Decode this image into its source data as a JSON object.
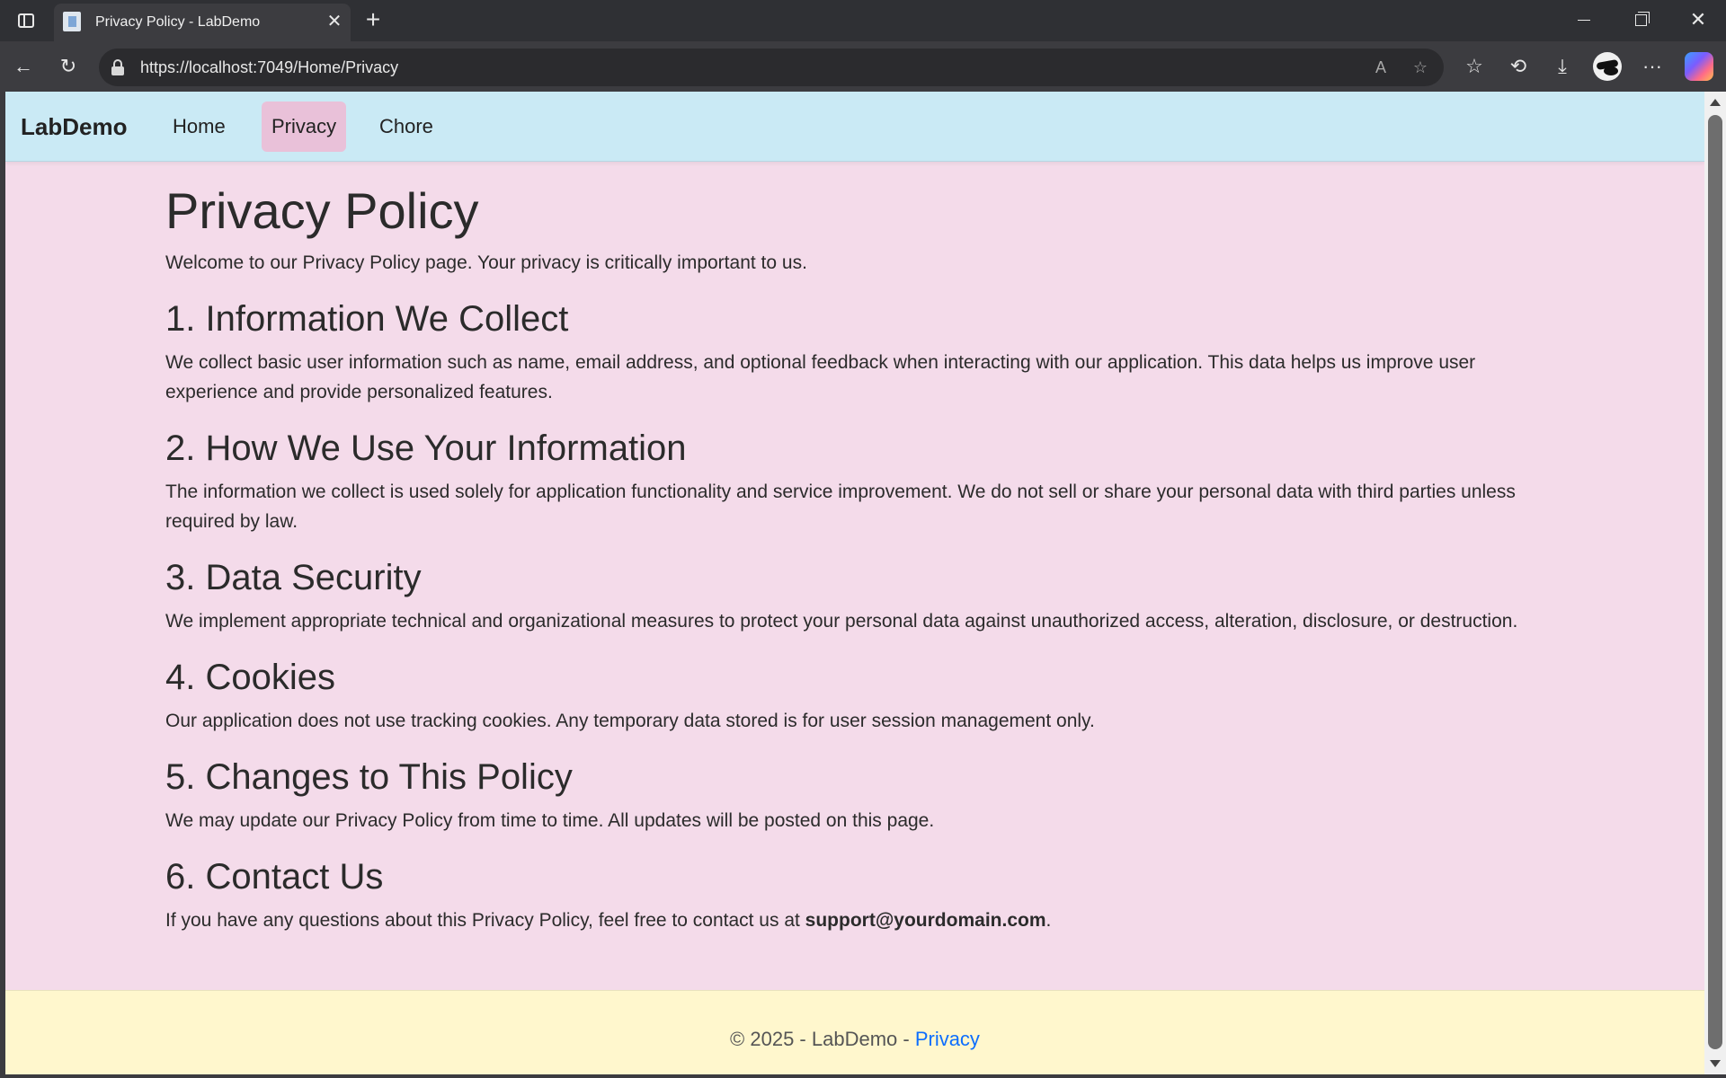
{
  "browser": {
    "tab_title": "Privacy Policy - LabDemo",
    "tab_close": "✕",
    "new_tab": "+",
    "url": "https://localhost:7049/Home/Privacy",
    "back": "←",
    "reload": "↻",
    "read_aloud": "A",
    "favorite": "☆",
    "favorites": "☆",
    "history": "⟲",
    "downloads": "⤓",
    "more": "···",
    "win_close": "✕"
  },
  "navbar": {
    "brand": "LabDemo",
    "links": [
      "Home",
      "Privacy",
      "Chore"
    ]
  },
  "content": {
    "title": "Privacy Policy",
    "intro": "Welcome to our Privacy Policy page. Your privacy is critically important to us.",
    "sections": [
      {
        "heading": "1. Information We Collect",
        "text": "We collect basic user information such as name, email address, and optional feedback when interacting with our application. This data helps us improve user experience and provide personalized features."
      },
      {
        "heading": "2. How We Use Your Information",
        "text": "The information we collect is used solely for application functionality and service improvement. We do not sell or share your personal data with third parties unless required by law."
      },
      {
        "heading": "3. Data Security",
        "text": "We implement appropriate technical and organizational measures to protect your personal data against unauthorized access, alteration, disclosure, or destruction."
      },
      {
        "heading": "4. Cookies",
        "text": "Our application does not use tracking cookies. Any temporary data stored is for user session management only."
      },
      {
        "heading": "5. Changes to This Policy",
        "text": "We may update our Privacy Policy from time to time. All updates will be posted on this page."
      },
      {
        "heading": "6. Contact Us",
        "text_before": "If you have any questions about this Privacy Policy, feel free to contact us at ",
        "email": "support@yourdomain.com",
        "text_after": "."
      }
    ]
  },
  "footer": {
    "text": "© 2025 - LabDemo - ",
    "link": "Privacy"
  },
  "colors": {
    "navbar_bg": "#caeaf5",
    "page_bg": "#f4dbea",
    "active_nav_bg": "#e9c1d9",
    "footer_bg": "#fff7cd",
    "link": "#0d6efd"
  }
}
